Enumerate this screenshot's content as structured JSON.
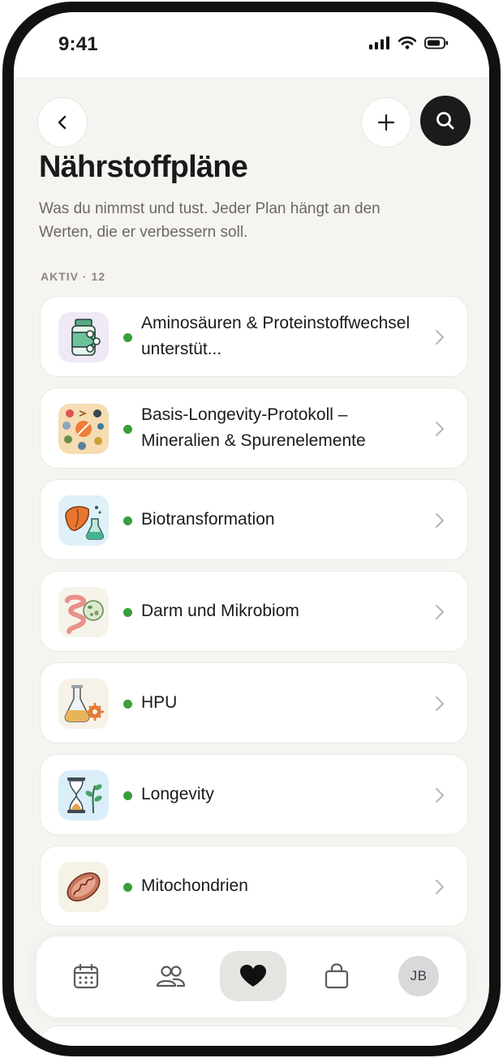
{
  "status_bar": {
    "time": "9:41"
  },
  "header": {
    "title": "Nährstoffpläne",
    "subtitle": "Was du nimmst und tust. Jeder Plan hängt an den Werten, die er verbessern soll."
  },
  "section": {
    "label": "AKTIV · 12"
  },
  "plans": [
    {
      "title": "Aminosäuren & Proteinstoffwechsel unterstüt...",
      "icon": "amino-bottle-icon",
      "status_color": "#3a9d3a"
    },
    {
      "title": "Basis-Longevity-Protokoll – Mineralien & Spurenelemente",
      "icon": "minerals-icon",
      "status_color": "#3a9d3a"
    },
    {
      "title": "Biotransformation",
      "icon": "liver-flask-icon",
      "status_color": "#3a9d3a"
    },
    {
      "title": "Darm und Mikrobiom",
      "icon": "intestine-microbiome-icon",
      "status_color": "#3a9d3a"
    },
    {
      "title": "HPU",
      "icon": "flask-gear-icon",
      "status_color": "#3a9d3a"
    },
    {
      "title": "Longevity",
      "icon": "hourglass-plant-icon",
      "status_color": "#3a9d3a"
    },
    {
      "title": "Mitochondrien",
      "icon": "mitochondrion-icon",
      "status_color": "#3a9d3a"
    }
  ],
  "tabbar": {
    "avatar_initials": "JB",
    "tabs": [
      "calendar-icon",
      "people-icon",
      "heart-icon",
      "bag-icon",
      "avatar"
    ]
  },
  "colors": {
    "background": "#f6f4f0",
    "accent_dark": "#1b1b1b",
    "status_active": "#3a9d3a"
  }
}
